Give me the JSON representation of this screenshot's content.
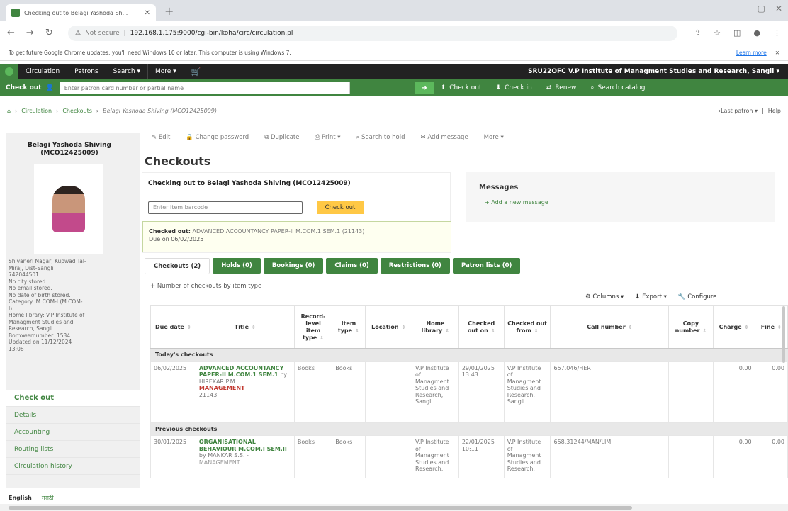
{
  "browser": {
    "tab_title": "Checking out to Belagi Yashoda Sh...",
    "url_security": "Not secure",
    "url": "192.168.1.175:9000/cgi-bin/koha/circ/circulation.pl",
    "infobar_text": "To get future Google Chrome updates, you'll need Windows 10 or later. This computer is using Windows 7.",
    "infobar_link": "Learn more"
  },
  "nav": {
    "items": [
      "Circulation",
      "Patrons",
      "Search",
      "More"
    ],
    "library_code": "SRU22OFC",
    "library_name": "V.P Institute of Managment Studies and Research, Sangli"
  },
  "checkbar": {
    "label": "Check out",
    "placeholder": "Enter patron card number or partial name",
    "links": [
      "Check out",
      "Check in",
      "Renew",
      "Search catalog"
    ]
  },
  "breadcrumb": {
    "items": [
      "Circulation",
      "Checkouts"
    ],
    "current": "Belagi Yashoda Shiving (MCO12425009)",
    "right": [
      "Last patron",
      "Help"
    ]
  },
  "patron": {
    "name": "Belagi Yashoda Shiving (MCO12425009)",
    "info": [
      "Shivaneri Nagar, Kupwad Tal-",
      "Miraj, Dist-Sangli",
      "742044501",
      "No city stored.",
      "No email stored.",
      "No date of birth stored.",
      "Category: M.COM-I (M.COM-",
      "I)",
      "Home library: V.P Institute of",
      "Managment Studies and",
      "Research, Sangli",
      "Borrowernumber: 1534",
      "Updated on 11/12/2024",
      "13:08"
    ]
  },
  "sidenav": [
    "Check out",
    "Details",
    "Accounting",
    "Routing lists",
    "Circulation history"
  ],
  "toolbar": [
    "Edit",
    "Change password",
    "Duplicate",
    "Print",
    "Search to hold",
    "Add message",
    "More"
  ],
  "page_title": "Checkouts",
  "checkout_box": {
    "title": "Checking out to Belagi Yashoda Shiving (MCO12425009)",
    "placeholder": "Enter item barcode",
    "button": "Check out",
    "alert_label": "Checked out:",
    "alert_text": "ADVANCED ACCOUNTANCY PAPER-II M.COM.1 SEM.1 (21143)",
    "due": "Due on 06/02/2025"
  },
  "messages": {
    "heading": "Messages",
    "add": "+ Add a new message"
  },
  "tabs": [
    "Checkouts (2)",
    "Holds (0)",
    "Bookings (0)",
    "Claims (0)",
    "Restrictions (0)",
    "Patron lists (0)"
  ],
  "by_type": "+ Number of checkouts by item type",
  "table_controls": [
    "Columns",
    "Export",
    "Configure"
  ],
  "table": {
    "headers": [
      "Due date",
      "Title",
      "Record-level item type",
      "Item type",
      "Location",
      "Home library",
      "Checked out on",
      "Checked out from",
      "Call number",
      "Copy number",
      "Charge",
      "Fine"
    ],
    "groups": [
      {
        "label": "Today's checkouts",
        "rows": [
          {
            "due": "06/02/2025",
            "title": "ADVANCED ACCOUNTANCY PAPER-II M.COM.1 SEM.1",
            "by": "by HIREKAR P.M.",
            "publisher": "MANAGEMENT",
            "barcode": "21143",
            "rec_type": "Books",
            "item_type": "Books",
            "location": "",
            "home": "V.P Institute of Managment Studies and Research, Sangli",
            "out_on": "29/01/2025 13:43",
            "out_from": "V.P Institute of Managment Studies and Research, Sangli",
            "call": "657.046/HER",
            "copy": "",
            "charge": "0.00",
            "fine": "0.00"
          }
        ]
      },
      {
        "label": "Previous checkouts",
        "rows": [
          {
            "due": "30/01/2025",
            "title": "ORGANISATIONAL BEHAVIOUR M.COM.I SEM.II",
            "by": "by MANKAR S.S. -",
            "publisher": "MANAGEMENT",
            "barcode": "",
            "rec_type": "Books",
            "item_type": "Books",
            "location": "",
            "home": "V.P Institute of Managment Studies and Research,",
            "out_on": "22/01/2025 10:11",
            "out_from": "V.P Institute of Managment Studies and Research,",
            "call": "658.31244/MAN/LIM",
            "copy": "",
            "charge": "0.00",
            "fine": "0.00"
          }
        ]
      }
    ]
  },
  "lang": [
    "English",
    "मराठी"
  ]
}
